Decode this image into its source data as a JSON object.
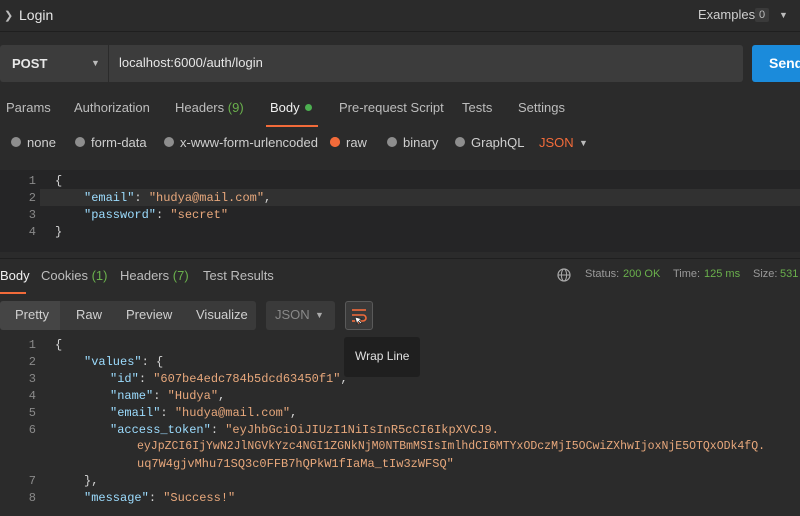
{
  "header": {
    "title": "Login",
    "examples_label": "Examples",
    "examples_count": "0"
  },
  "request": {
    "method": "POST",
    "url": "localhost:6000/auth/login",
    "send_label": "Send"
  },
  "request_tabs": {
    "params": "Params",
    "authorization": "Authorization",
    "headers": "Headers",
    "headers_count": "(9)",
    "body": "Body",
    "prerequest": "Pre-request Script",
    "tests": "Tests",
    "settings": "Settings"
  },
  "body_types": {
    "none": "none",
    "form_data": "form-data",
    "urlencoded": "x-www-form-urlencoded",
    "raw": "raw",
    "binary": "binary",
    "graphql": "GraphQL",
    "format": "JSON",
    "selected": "raw"
  },
  "request_body": {
    "line_numbers": [
      "1",
      "2",
      "3",
      "4"
    ],
    "open_brace": "{",
    "close_brace": "}",
    "email_key": "\"email\"",
    "email_value": "\"hudya@mail.com\"",
    "password_key": "\"password\"",
    "password_value": "\"secret\"",
    "colon": ": ",
    "comma": ","
  },
  "response_tabs": {
    "body": "Body",
    "cookies": "Cookies",
    "cookies_count": "(1)",
    "headers": "Headers",
    "headers_count": "(7)",
    "test_results": "Test Results"
  },
  "status": {
    "status_label": "Status:",
    "status_value": "200 OK",
    "time_label": "Time:",
    "time_value": "125 ms",
    "size_label": "Size:",
    "size_value": "531"
  },
  "format_bar": {
    "pretty": "Pretty",
    "raw": "Raw",
    "preview": "Preview",
    "visualize": "Visualize",
    "format": "JSON",
    "tooltip": "Wrap Line"
  },
  "response_body": {
    "line_numbers": [
      "1",
      "2",
      "3",
      "4",
      "5",
      "6",
      "7",
      "8"
    ],
    "open_brace": "{",
    "values_key": "\"values\"",
    "id_key": "\"id\"",
    "id_value": "\"607be4edc784b5dcd63450f1\"",
    "name_key": "\"name\"",
    "name_value": "\"Hudya\"",
    "email_key": "\"email\"",
    "email_value": "\"hudya@mail.com\"",
    "token_key": "\"access_token\"",
    "token_line1": "\"eyJhbGciOiJIUzI1NiIsInR5cCI6IkpXVCJ9.",
    "token_line2": "eyJpZCI6IjYwN2JlNGVkYzc4NGI1ZGNkNjM0NTBmMSIsImlhdCI6MTYxODczMjI5OCwiZXhwIjoxNjE5OTQxODk4fQ.",
    "token_line3": "uq7W4gjvMhu71SQ3c0FFB7hQPkW1fIaMa_tIw3zWFSQ\"",
    "close_values": "},",
    "message_key": "\"message\"",
    "message_value": "\"Success!\""
  },
  "colors": {
    "accent": "#f26b3a",
    "send": "#1b8bdb",
    "success": "#6ab04c"
  }
}
